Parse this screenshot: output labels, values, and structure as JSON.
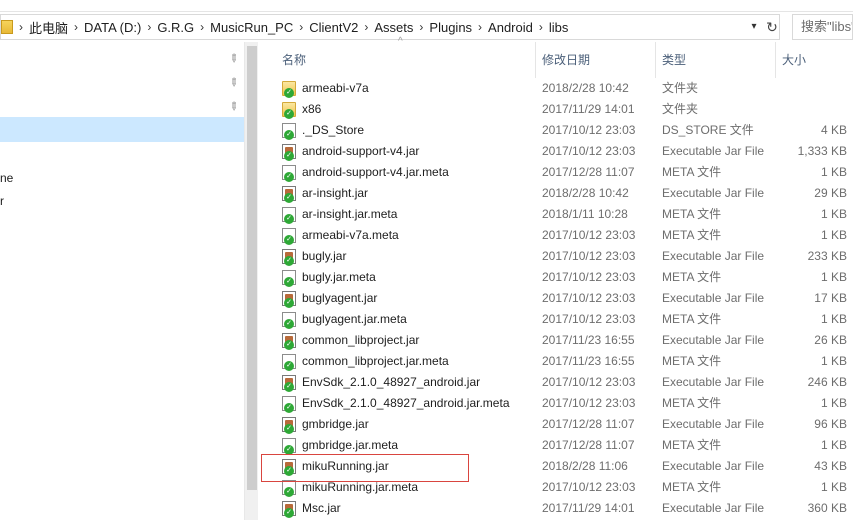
{
  "address_bar": {
    "crumbs": [
      "此电脑",
      "DATA (D:)",
      "G.R.G",
      "MusicRun_PC",
      "ClientV2",
      "Assets",
      "Plugins",
      "Android",
      "libs"
    ]
  },
  "search": {
    "placeholder": "搜索\"libs\""
  },
  "nav": {
    "fragments": [
      "ne",
      "r"
    ]
  },
  "columns": {
    "name": "名称",
    "date": "修改日期",
    "type": "类型",
    "size": "大小"
  },
  "files": [
    {
      "name": "armeabi-v7a",
      "date": "2018/2/28 10:42",
      "type": "文件夹",
      "size": "",
      "icon": "folder-icon"
    },
    {
      "name": "x86",
      "date": "2017/11/29 14:01",
      "type": "文件夹",
      "size": "",
      "icon": "folder-icon"
    },
    {
      "name": "._DS_Store",
      "date": "2017/10/12 23:03",
      "type": "DS_STORE 文件",
      "size": "4 KB",
      "icon": "file-icon"
    },
    {
      "name": "android-support-v4.jar",
      "date": "2017/10/12 23:03",
      "type": "Executable Jar File",
      "size": "1,333 KB",
      "icon": "jar-icon"
    },
    {
      "name": "android-support-v4.jar.meta",
      "date": "2017/12/28 11:07",
      "type": "META 文件",
      "size": "1 KB",
      "icon": "file-icon"
    },
    {
      "name": "ar-insight.jar",
      "date": "2018/2/28 10:42",
      "type": "Executable Jar File",
      "size": "29 KB",
      "icon": "jar-icon"
    },
    {
      "name": "ar-insight.jar.meta",
      "date": "2018/1/11 10:28",
      "type": "META 文件",
      "size": "1 KB",
      "icon": "file-icon"
    },
    {
      "name": "armeabi-v7a.meta",
      "date": "2017/10/12 23:03",
      "type": "META 文件",
      "size": "1 KB",
      "icon": "file-icon"
    },
    {
      "name": "bugly.jar",
      "date": "2017/10/12 23:03",
      "type": "Executable Jar File",
      "size": "233 KB",
      "icon": "jar-icon"
    },
    {
      "name": "bugly.jar.meta",
      "date": "2017/10/12 23:03",
      "type": "META 文件",
      "size": "1 KB",
      "icon": "file-icon"
    },
    {
      "name": "buglyagent.jar",
      "date": "2017/10/12 23:03",
      "type": "Executable Jar File",
      "size": "17 KB",
      "icon": "jar-icon"
    },
    {
      "name": "buglyagent.jar.meta",
      "date": "2017/10/12 23:03",
      "type": "META 文件",
      "size": "1 KB",
      "icon": "file-icon"
    },
    {
      "name": "common_libproject.jar",
      "date": "2017/11/23 16:55",
      "type": "Executable Jar File",
      "size": "26 KB",
      "icon": "jar-icon"
    },
    {
      "name": "common_libproject.jar.meta",
      "date": "2017/11/23 16:55",
      "type": "META 文件",
      "size": "1 KB",
      "icon": "file-icon"
    },
    {
      "name": "EnvSdk_2.1.0_48927_android.jar",
      "date": "2017/10/12 23:03",
      "type": "Executable Jar File",
      "size": "246 KB",
      "icon": "jar-icon"
    },
    {
      "name": "EnvSdk_2.1.0_48927_android.jar.meta",
      "date": "2017/10/12 23:03",
      "type": "META 文件",
      "size": "1 KB",
      "icon": "file-icon"
    },
    {
      "name": "gmbridge.jar",
      "date": "2017/12/28 11:07",
      "type": "Executable Jar File",
      "size": "96 KB",
      "icon": "jar-icon"
    },
    {
      "name": "gmbridge.jar.meta",
      "date": "2017/12/28 11:07",
      "type": "META 文件",
      "size": "1 KB",
      "icon": "file-icon"
    },
    {
      "name": "mikuRunning.jar",
      "date": "2018/2/28 11:06",
      "type": "Executable Jar File",
      "size": "43 KB",
      "icon": "jar-icon"
    },
    {
      "name": "mikuRunning.jar.meta",
      "date": "2017/10/12 23:03",
      "type": "META 文件",
      "size": "1 KB",
      "icon": "file-icon"
    },
    {
      "name": "Msc.jar",
      "date": "2017/11/29 14:01",
      "type": "Executable Jar File",
      "size": "360 KB",
      "icon": "jar-icon"
    }
  ],
  "colors": {
    "nav_selected": "#cce8ff",
    "highlight_box": "#d9453f",
    "header_text": "#4c607a"
  }
}
